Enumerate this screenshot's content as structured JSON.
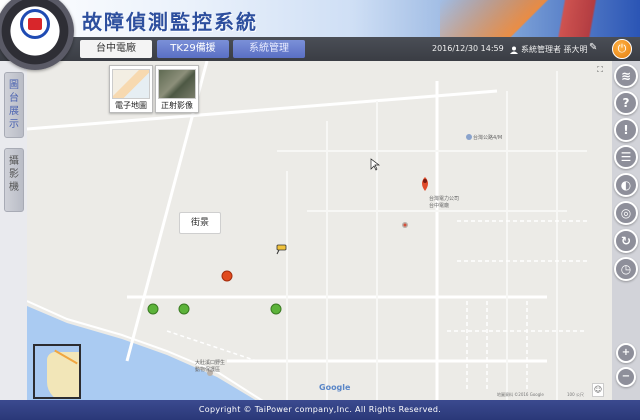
{
  "header": {
    "title": "故障偵測監控系統",
    "logo": "taipower-logo"
  },
  "nav": {
    "tabs": [
      {
        "label": "台中電廠",
        "active": true
      },
      {
        "label": "TK29備援",
        "active": false
      },
      {
        "label": "系統管理",
        "active": false
      }
    ],
    "datetime": "2016/12/30 14:59",
    "user": "系統管理者 孫大明",
    "icons": {
      "user": "user-icon",
      "edit": "edit-icon",
      "power": "power-icon"
    }
  },
  "sidebar": {
    "tabs": [
      {
        "label": "圖台展示",
        "chars": [
          "圖",
          "台",
          "展",
          "示"
        ]
      },
      {
        "label": "攝影機",
        "chars": [
          "攝",
          "影",
          "機"
        ]
      }
    ]
  },
  "map": {
    "map_types": [
      {
        "label": "電子地圖"
      },
      {
        "label": "正射影像"
      }
    ],
    "street_label": "街景",
    "minimap_icon": "minimap-icon",
    "google_logo": "Google",
    "attribution": "地圖資料 ©2016 Google",
    "scale": "100 公尺",
    "poi": {
      "power_station": "台灣電力公司\n台中電廠",
      "bus_stop": "台灣公路4/M",
      "park": "大肚溪口野生\n動物保護區"
    },
    "markers": [
      {
        "status": "red"
      },
      {
        "status": "green"
      },
      {
        "status": "green"
      },
      {
        "status": "green"
      }
    ]
  },
  "toolbar": {
    "icons": [
      "layers-icon",
      "help-icon",
      "warning-icon",
      "list-icon",
      "camera-icon",
      "location-icon",
      "refresh-icon",
      "timer-icon"
    ]
  },
  "footer": {
    "text": "Copyright © TaiPower company,Inc. All Rights Reserved."
  },
  "colors": {
    "accent": "#5a6fc4",
    "header_dark": "#2d4f9e",
    "footer": "#2a3878",
    "marker_red": "#e04b1e",
    "marker_green": "#5cb33a",
    "toolbar": "#d2d3d9"
  }
}
